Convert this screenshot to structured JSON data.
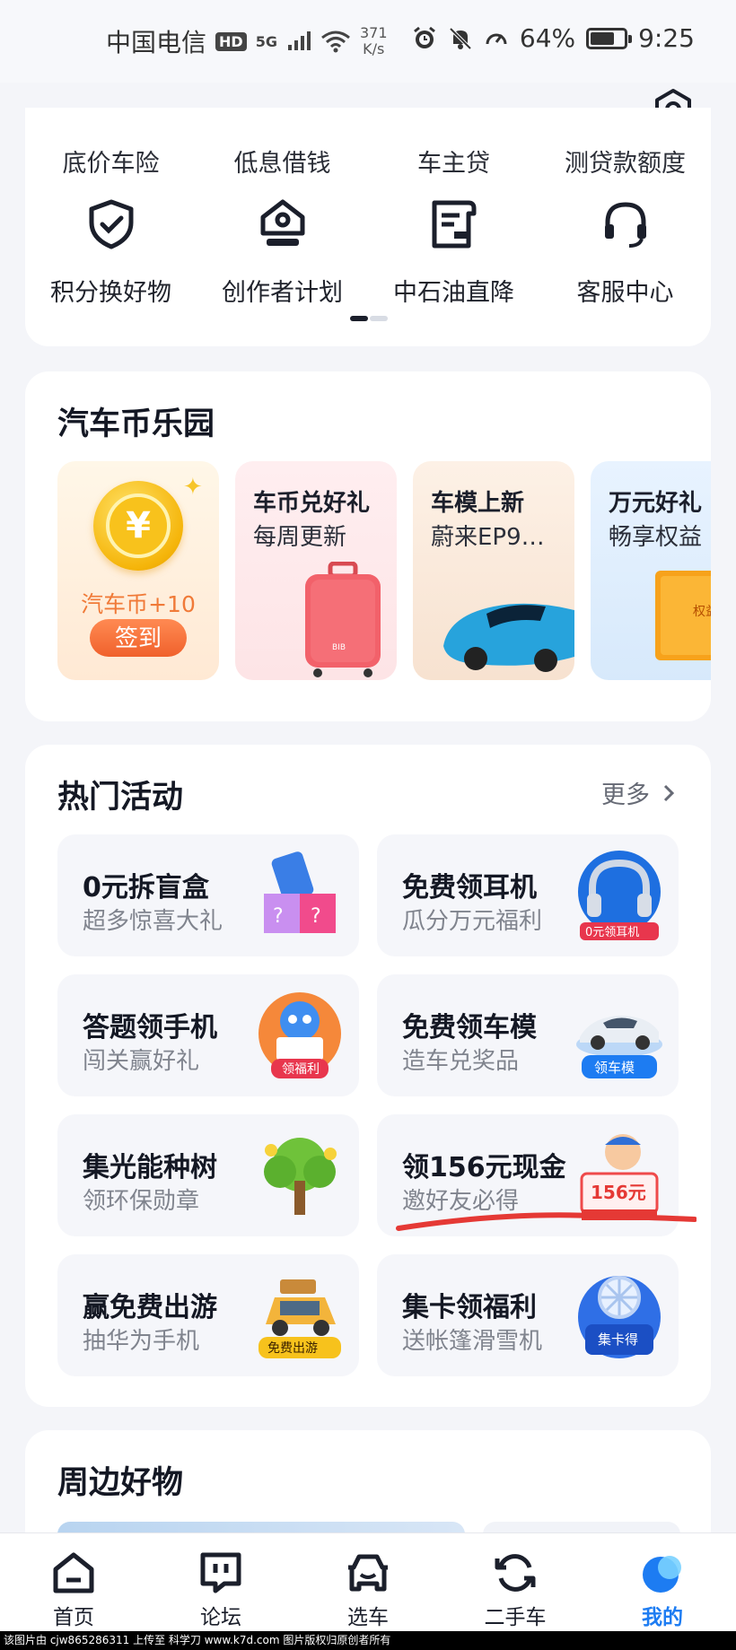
{
  "status_bar": {
    "carrier": "中国电信",
    "hd": "HD",
    "signal": "5G",
    "speed_value": "371",
    "speed_unit": "K/s",
    "battery": "64%",
    "time": "9:25"
  },
  "top_services": {
    "cut_labels": [
      "底价车险",
      "低息借钱",
      "车主贷",
      "测贷款额度"
    ],
    "items": [
      {
        "label": "积分换好物",
        "icon": "shield-check-icon"
      },
      {
        "label": "创作者计划",
        "icon": "creator-badge-icon"
      },
      {
        "label": "中石油直降",
        "icon": "fuel-card-icon"
      },
      {
        "label": "客服中心",
        "icon": "headset-icon"
      }
    ]
  },
  "coin_park": {
    "title": "汽车币乐园",
    "sign_card": {
      "coin_text": "汽车币+10",
      "button": "签到",
      "coin_symbol": "¥"
    },
    "tiles": [
      {
        "line1": "车币兑好礼",
        "line2": "每周更新"
      },
      {
        "line1": "车模上新",
        "line2": "蔚来EP9…"
      },
      {
        "line1": "万元好礼",
        "line2": "畅享权益"
      }
    ]
  },
  "hot_activities": {
    "title": "热门活动",
    "more": "更多",
    "items": [
      {
        "title": "0元拆盲盒",
        "subtitle": "超多惊喜大礼"
      },
      {
        "title": "免费领耳机",
        "subtitle": "瓜分万元福利",
        "badge": "0元领耳机"
      },
      {
        "title": "答题领手机",
        "subtitle": "闯关赢好礼",
        "badge": "领福利"
      },
      {
        "title": "免费领车模",
        "subtitle": "造车兑奖品",
        "badge": "领车模"
      },
      {
        "title": "集光能种树",
        "subtitle": "领环保勋章"
      },
      {
        "title": "领156元现金",
        "subtitle": "邀好友必得",
        "badge": "156元"
      },
      {
        "title": "赢免费出游",
        "subtitle": "抽华为手机",
        "badge": "免费出游"
      },
      {
        "title": "集卡领福利",
        "subtitle": "送帐篷滑雪机",
        "badge": "集卡得"
      }
    ]
  },
  "nearby": {
    "title": "周边好物"
  },
  "bottom_nav": {
    "items": [
      {
        "label": "首页",
        "icon": "home-icon"
      },
      {
        "label": "论坛",
        "icon": "forum-icon"
      },
      {
        "label": "选车",
        "icon": "car-icon"
      },
      {
        "label": "二手车",
        "icon": "refresh-icon"
      },
      {
        "label": "我的",
        "icon": "profile-icon"
      }
    ]
  },
  "footer": "该图片由 cjw865286311 上传至 科学刀 www.k7d.com 图片版权归原创者所有",
  "colors": {
    "accent": "#1d7cf2",
    "orange": "#f0612c",
    "highlight": "#e53935"
  }
}
